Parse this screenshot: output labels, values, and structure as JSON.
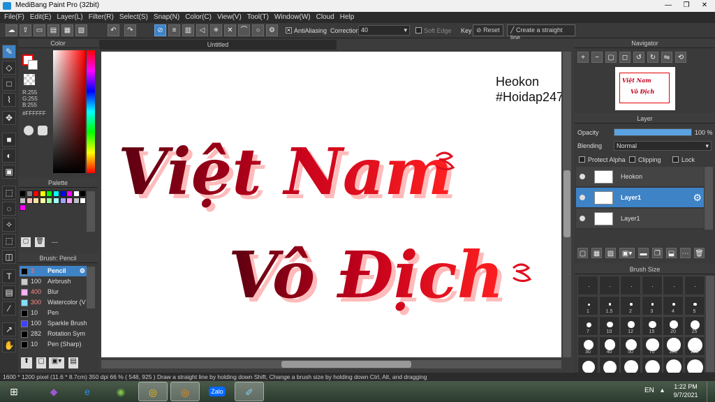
{
  "window": {
    "title": "MediBang Paint Pro (32bit)",
    "minimize": "—",
    "maximize": "❐",
    "close": "✕"
  },
  "menu": [
    "File(F)",
    "Edit(E)",
    "Layer(L)",
    "Filter(R)",
    "Select(S)",
    "Snap(N)",
    "Color(C)",
    "View(V)",
    "Tool(T)",
    "Window(W)",
    "Cloud",
    "Help"
  ],
  "toolbar": {
    "antialiasing": "AntiAliasing",
    "correction_label": "Correction",
    "correction_value": "40",
    "soft_edge": "Soft Edge",
    "key_label": "Key",
    "reset": "Reset",
    "straight_line": "Create a straight line"
  },
  "color_panel": {
    "title": "Color",
    "r": "R:255",
    "g": "G:255",
    "b": "B:255",
    "hex": "#FFFFFF",
    "fg": "#ff0000",
    "bg": "#ffffff"
  },
  "palette": {
    "title": "Palette",
    "colors": [
      "#000000",
      "#808080",
      "#ff0000",
      "#ffff00",
      "#00ff00",
      "#00ffff",
      "#0000ff",
      "#ff00ff",
      "#ffffff",
      "#000000",
      "#c0c0c0",
      "#ffc0c0",
      "#ffe0a0",
      "#ffffa0",
      "#a0ffa0",
      "#a0ffff",
      "#a0a0ff",
      "#ffa0ff",
      "#c0c0c0",
      "#ffffff",
      "#ff00ff"
    ],
    "extra_label": "---"
  },
  "brush_panel": {
    "title": "Brush: Pencil",
    "items": [
      {
        "size": "3",
        "name": "Pencil",
        "color": "#000000",
        "selected": true
      },
      {
        "size": "100",
        "name": "Airbrush",
        "color": "#cccccc"
      },
      {
        "size": "400",
        "name": "Blur",
        "color": "#ffb0ff"
      },
      {
        "size": "300",
        "name": "Watercolor (V",
        "color": "#80e0ff"
      },
      {
        "size": "10",
        "name": "Pen",
        "color": "#000000"
      },
      {
        "size": "100",
        "name": "Sparkle Brush",
        "color": "#4040ff"
      },
      {
        "size": "282",
        "name": "Rotation Sym",
        "color": "#000000"
      },
      {
        "size": "10",
        "name": "Pen (Sharp)",
        "color": "#000000"
      }
    ]
  },
  "canvas": {
    "tab": "Untitled",
    "text_line1": "Heokon",
    "text_line2": "#Hoidap247",
    "art_line1": "Việt Nam",
    "art_line2": "Vô Địch"
  },
  "navigator": {
    "title": "Navigator",
    "thumb_line1": "Việt Nam",
    "thumb_line2": "Vô Địch"
  },
  "layer_panel": {
    "title": "Layer",
    "opacity_label": "Opacity",
    "opacity_value": "100 %",
    "opacity": 1.0,
    "blending_label": "Blending",
    "blending_value": "Normal",
    "protect_alpha": "Protect Alpha",
    "clipping": "Clipping",
    "lock": "Lock",
    "layers": [
      {
        "name": "Heokon",
        "selected": false
      },
      {
        "name": "Layer1",
        "selected": true
      },
      {
        "name": "Layer1",
        "selected": false
      }
    ]
  },
  "brush_size": {
    "title": "Brush Size",
    "sizes": [
      "",
      "",
      "",
      "",
      "",
      "",
      "1",
      "1.5",
      "2",
      "3",
      "4",
      "5",
      "7",
      "10",
      "12",
      "15",
      "20",
      "25",
      "30",
      "40",
      "50",
      "70",
      "100",
      "150",
      "",
      "",
      "",
      "",
      "",
      ""
    ]
  },
  "status": "1600 * 1200 pixel   (11.6 * 8.7cm)   350 dpi   66 %   ( 548, 925 )   Draw a straight line by holding down Shift, Change a brush size by holding down Ctrl, Alt, and dragging",
  "taskbar": {
    "lang": "EN",
    "time": "1:22 PM",
    "date": "9/7/2021",
    "zalo": "Zalo"
  }
}
